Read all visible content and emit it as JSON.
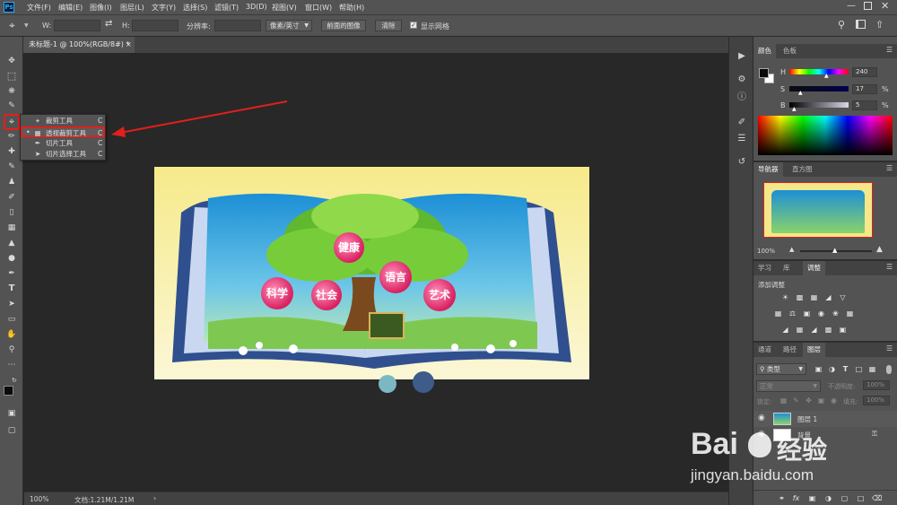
{
  "menubar": {
    "app_logo": "Ps",
    "items": [
      "文件(F)",
      "编辑(E)",
      "图像(I)",
      "图层(L)",
      "文字(Y)",
      "选择(S)",
      "滤镜(T)",
      "3D(D)",
      "视图(V)",
      "窗口(W)",
      "帮助(H)"
    ]
  },
  "options": {
    "w_label": "W:",
    "h_label": "H:",
    "resolution_label": "分辨率:",
    "unit_select": "像素/英寸",
    "front_image_btn": "前面的图像",
    "clear_btn": "清除",
    "show_grid_label": "显示网格"
  },
  "document": {
    "tab_title": "未标题-1 @ 100%(RGB/8#) *",
    "zoom": "100%",
    "doc_info": "文档:1.21M/1.21M"
  },
  "flyout": {
    "items": [
      {
        "label": "裁剪工具",
        "key": "C"
      },
      {
        "label": "透视裁剪工具",
        "key": "C"
      },
      {
        "label": "切片工具",
        "key": "C"
      },
      {
        "label": "切片选择工具",
        "key": "C"
      }
    ]
  },
  "image": {
    "words": [
      "健康",
      "科学",
      "社会",
      "语言",
      "艺术"
    ]
  },
  "color_panel": {
    "tabs": [
      "颜色",
      "色板"
    ],
    "h_label": "H",
    "h_value": "240",
    "s_label": "S",
    "s_value": "17",
    "s_unit": "%",
    "b_label": "B",
    "b_value": "5",
    "b_unit": "%",
    "foreground": "#0b0b0d"
  },
  "navigator": {
    "tabs": [
      "导航器",
      "直方图"
    ],
    "zoom": "100%"
  },
  "adjust_panel": {
    "tabs": [
      "学习",
      "库",
      "调整"
    ],
    "add_adjustment": "添加调整"
  },
  "layers_panel": {
    "tabs": [
      "通道",
      "路径",
      "图层"
    ],
    "filter_kind": "类型",
    "blend_mode": "正常",
    "opacity_label": "不透明度:",
    "opacity_value": "100%",
    "lock_label": "锁定:",
    "fill_label": "填充:",
    "fill_value": "100%",
    "layers": [
      {
        "name": "图层 1"
      },
      {
        "name": "背景"
      }
    ]
  },
  "watermark": {
    "brand": "Bai",
    "brand2": "经验",
    "url": "jingyan.baidu.com"
  },
  "colors": {
    "panel_bg": "#535353",
    "canvas_bg": "#282828",
    "highlight_red": "#e0201c",
    "accent_blue": "#31a8ff"
  }
}
